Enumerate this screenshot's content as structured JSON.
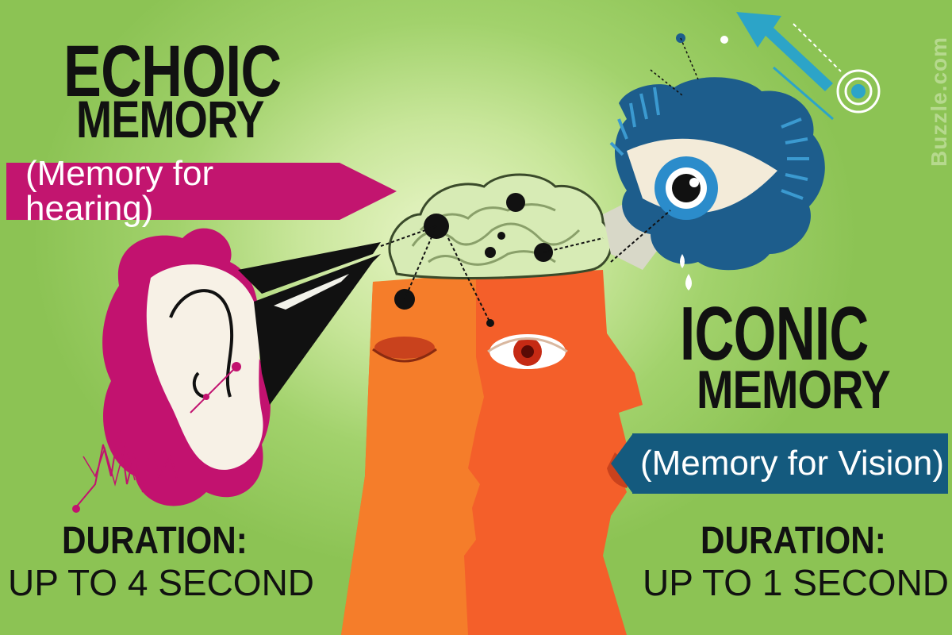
{
  "echoic": {
    "title_line1": "ECHOIC",
    "title_line2": "MEMORY",
    "subtitle": "(Memory for hearing)",
    "duration_label": "DURATION:",
    "duration_value": "UP TO 4 SECOND"
  },
  "iconic": {
    "title_line1": "ICONIC",
    "title_line2": "MEMORY",
    "subtitle": "(Memory for Vision)",
    "duration_label": "DURATION:",
    "duration_value": "UP TO 1 SECOND"
  },
  "watermark": "Buzzle.com",
  "colors": {
    "background": "#8cc354",
    "hearing_accent": "#c2156f",
    "vision_accent": "#145a7e",
    "face_orange": "#f26a2a",
    "brain_green": "#d7ebb5"
  },
  "icons": [
    "ear-icon",
    "eye-icon",
    "brain-icon",
    "head-profile-icon",
    "arrow-up-icon",
    "sound-wave-icon"
  ]
}
